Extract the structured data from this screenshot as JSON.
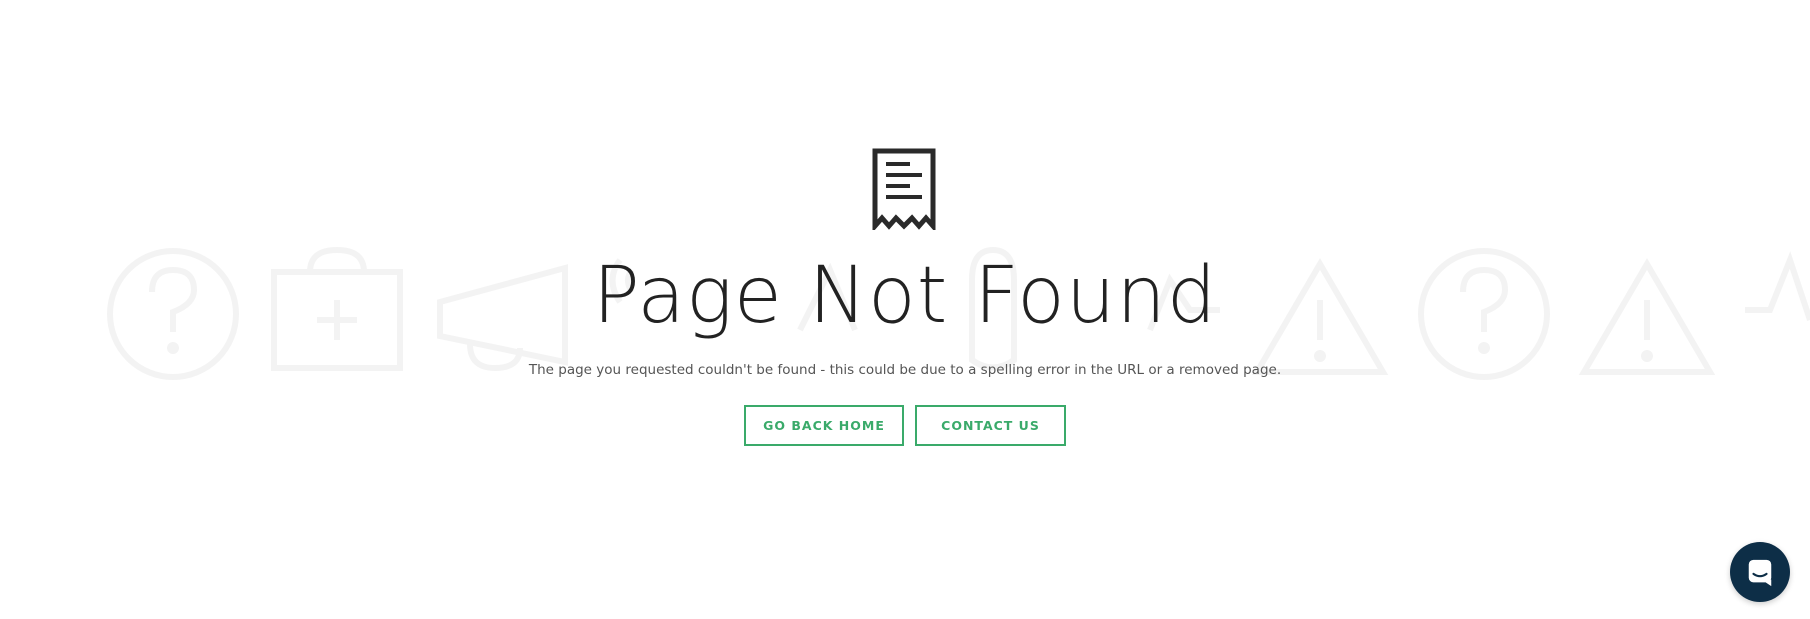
{
  "page": {
    "title": "Page Not Found",
    "description": "The page you requested couldn't be found - this could be due to a spelling error in the URL or a removed page."
  },
  "buttons": {
    "home_label": "GO BACK HOME",
    "contact_label": "CONTACT US"
  },
  "icons": {
    "main": "receipt-document-icon",
    "chat": "chat-launcher-icon",
    "background": [
      "question-circle-icon",
      "medical-kit-icon",
      "megaphone-icon",
      "wifi-signal-icon",
      "heartbeat-icon",
      "lock-icon",
      "heartbeat-icon",
      "warning-triangle-icon",
      "question-circle-icon",
      "warning-triangle-icon",
      "heartbeat-icon"
    ]
  },
  "colors": {
    "accent": "#3aaa6a",
    "title": "#222222",
    "text": "#555555",
    "chat_bg": "#0d2e47",
    "bg_icon": "#f4f4f4"
  }
}
